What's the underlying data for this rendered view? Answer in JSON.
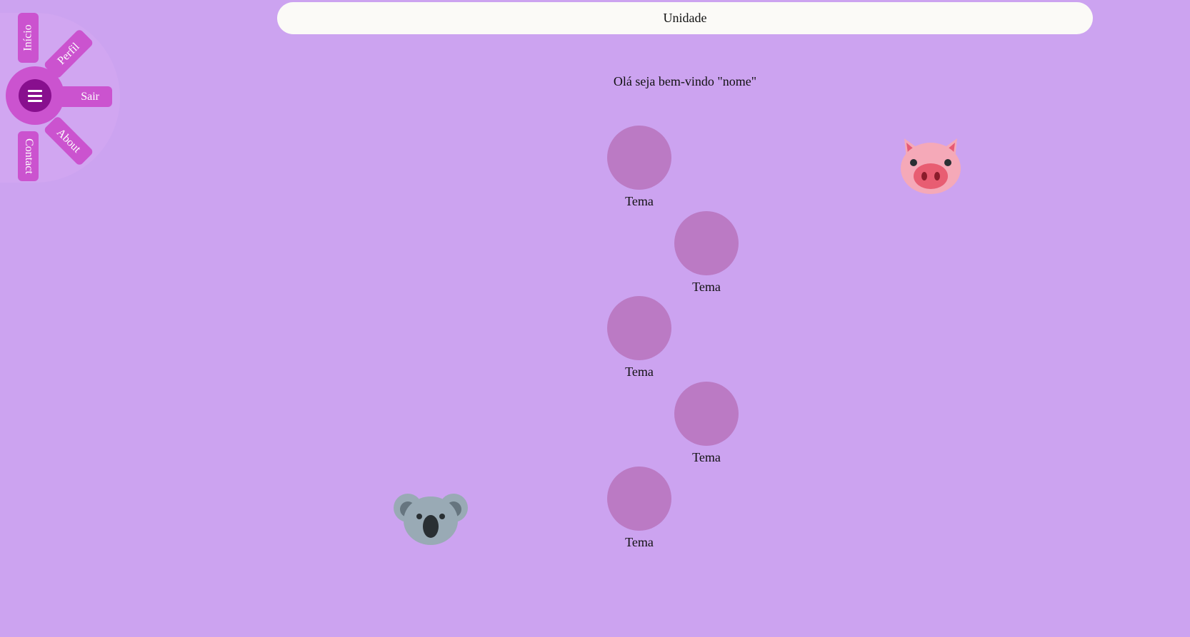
{
  "header": {
    "title": "Unidade"
  },
  "welcome": {
    "text": "Olá seja bem-vindo \"nome\""
  },
  "menu": {
    "toggle_icon": "hamburger-icon",
    "items": [
      {
        "label": "Início"
      },
      {
        "label": "Perfil"
      },
      {
        "label": "Sair"
      },
      {
        "label": "About"
      },
      {
        "label": "Contact"
      }
    ]
  },
  "nodes": [
    {
      "label": "Tema"
    },
    {
      "label": "Tema"
    },
    {
      "label": "Tema"
    },
    {
      "label": "Tema"
    },
    {
      "label": "Tema"
    }
  ],
  "decorations": {
    "pig": "pig-face-icon",
    "koala": "koala-icon"
  },
  "colors": {
    "background": "#cca3f0",
    "header_bg": "#fbfaf7",
    "node_fill": "#bb7ac4",
    "menu_accent": "#cb53cf",
    "menu_toggle": "#880f8e"
  }
}
